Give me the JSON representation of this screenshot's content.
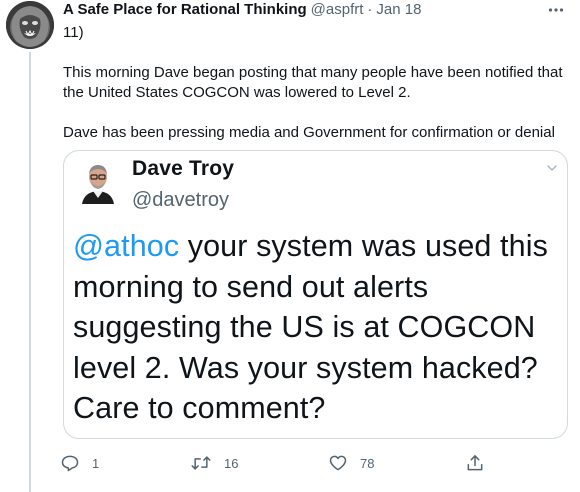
{
  "tweet": {
    "author_name": "A Safe Place for Rational Thinking",
    "author_handle": "@aspfrt",
    "separator": "·",
    "timestamp": "Jan 18",
    "more_label": "···",
    "paragraphs": [
      "11)",
      "This morning Dave began posting that many people have been notified that the United States COGCON was lowered to Level 2.",
      "Dave has been pressing media and Government for confirmation or denial"
    ]
  },
  "quote": {
    "name": "Dave Troy",
    "handle": "@davetroy",
    "mention": "@athoc",
    "text": " your system was used this morning to send out alerts suggesting the US is at COGCON level 2. Was your system hacked? Care to comment?"
  },
  "actions": {
    "reply_count": "1",
    "retweet_count": "16",
    "like_count": "78"
  },
  "icons": {
    "avatar": "lion-avatar-icon",
    "quote_avatar": "user-avatar-icon",
    "reply": "reply-icon",
    "retweet": "retweet-icon",
    "like": "heart-icon",
    "share": "share-icon",
    "more": "more-icon",
    "chevron": "chevron-down-icon"
  },
  "colors": {
    "link": "#1d9bf0",
    "secondary_text": "#536471",
    "border": "#cfd9de"
  }
}
